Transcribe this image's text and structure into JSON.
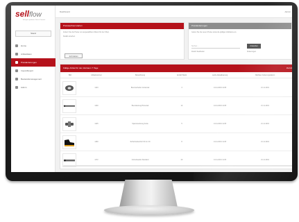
{
  "brand": {
    "part_a": "sell",
    "part_b": "flow",
    "tagline": "Sell your products Direct Connect"
  },
  "sidebar": {
    "button": "Stand",
    "items": [
      {
        "label": "Home",
        "icon": "home-icon",
        "active": false
      },
      {
        "label": "Artikeldaten",
        "icon": "list-icon",
        "active": false
      },
      {
        "label": "Preisänderungen",
        "icon": "tag-icon",
        "active": true
      },
      {
        "label": "Import/Export",
        "icon": "import-icon",
        "active": false
      },
      {
        "label": "Bestandsmanagement",
        "icon": "box-icon",
        "active": false
      },
      {
        "label": "Admin",
        "icon": "wrench-icon",
        "active": false
      }
    ]
  },
  "topbar": {
    "title": "Dashboard",
    "user": "Admin"
  },
  "panel_left": {
    "title": "Preiswechsel starten",
    "text": "Ändern Sie die Preise von ausgewählten Artikeln für den Shop.",
    "link": "Details ansehen",
    "button": "Jetzt starten"
  },
  "panel_right": {
    "title": "Preisänderungen",
    "text": "Geben Sie die neuen Preise sowie die gültigen Zeiträume an.",
    "field_placeholder": "Suchen...",
    "button": "Anwenden",
    "hint_left": "Zuletzt bearbeitet",
    "hint_right": "Änderungen"
  },
  "table": {
    "title": "Fällige Artikel für den Zeitraum 7 Tage",
    "action": "Zurück",
    "columns": [
      "Bild",
      "Artikelnummer",
      "Bezeichnung",
      "Anzahl Stück",
      "Letzte Aktualisierung",
      "Nächster Änderungsdatum"
    ],
    "rows": [
      {
        "thumb": "disc",
        "sku": "1123",
        "name": "Bremsscheibe Vorderrad",
        "qty": "3",
        "updated": "14.11.2019 11:05",
        "next": "21.11.2019"
      },
      {
        "thumb": "rod",
        "sku": "1130",
        "name": "Bremsleitung Hinterrad",
        "qty": "12",
        "updated": "14.11.2019 11:05",
        "next": "21.11.2019"
      },
      {
        "thumb": "tool",
        "sku": "1145",
        "name": "Spannwerkzeug Kette",
        "qty": "5",
        "updated": "14.11.2019 11:05",
        "next": "21.11.2019"
      },
      {
        "thumb": "shoe",
        "sku": "1160",
        "name": "Sicherheitsschuh S3 Gr. 43",
        "qty": "8",
        "updated": "14.11.2019 11:05",
        "next": "21.11.2019"
      },
      {
        "thumb": "bar",
        "sku": "1172",
        "name": "Antriebswelle Standard",
        "qty": "20",
        "updated": "14.11.2019 11:05",
        "next": "21.11.2019"
      }
    ]
  }
}
